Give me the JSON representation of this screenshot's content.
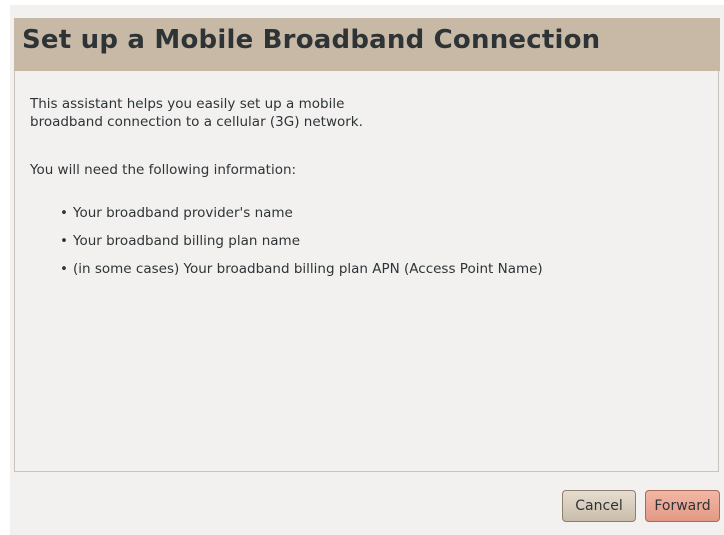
{
  "window": {
    "title": "Set up a Mobile Broadband Connection"
  },
  "content": {
    "intro_line1": "This assistant helps you easily set up a mobile",
    "intro_line2": "broadband connection to a cellular (3G) network.",
    "needed_heading": "You will need the following information:",
    "bullet_glyph": "•",
    "requirements": [
      "Your broadband provider's name",
      "Your broadband billing plan name",
      "(in some cases) Your broadband billing plan APN (Access Point Name)"
    ]
  },
  "buttons": {
    "cancel_label": "Cancel",
    "forward_label": "Forward"
  },
  "colors": {
    "header_background": "#c8b9a6",
    "dialog_background": "#f2f1f0",
    "forward_button": "#e29a85"
  }
}
